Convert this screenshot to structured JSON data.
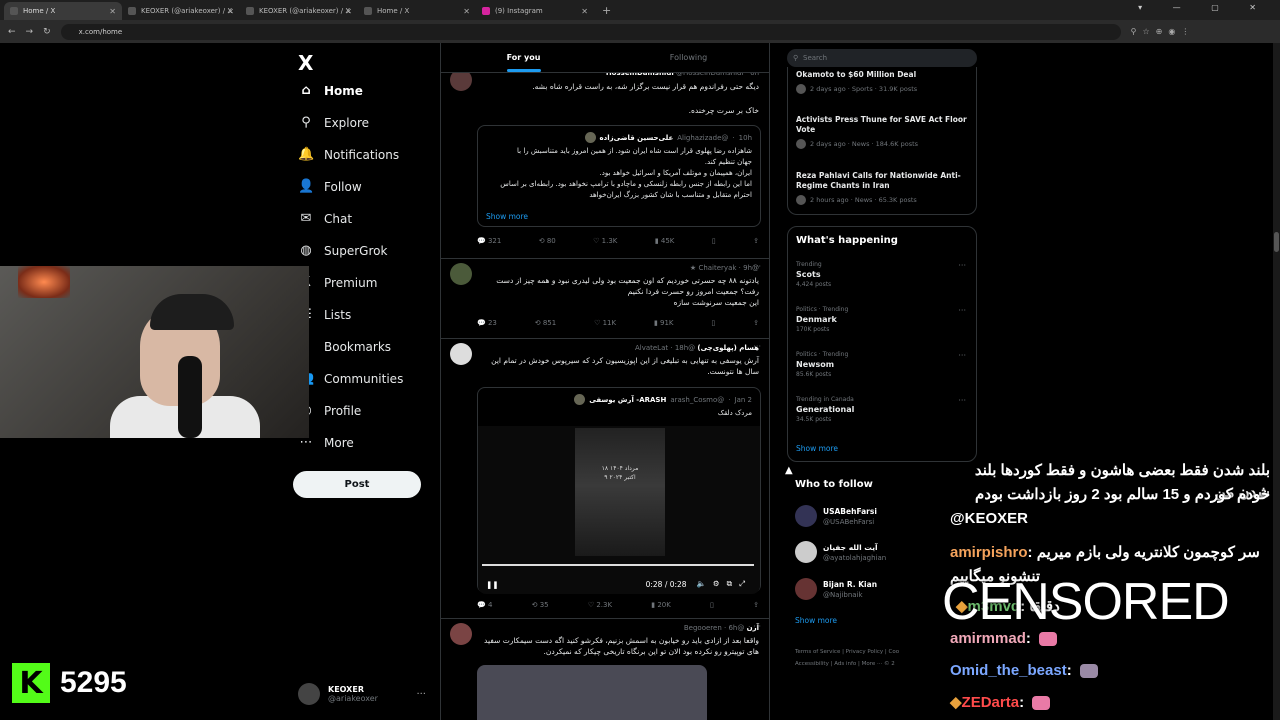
{
  "browser": {
    "tabs": [
      {
        "title": "Home / X",
        "active": true
      },
      {
        "title": "KEOXER (@ariakeoxer) / X",
        "active": false
      },
      {
        "title": "KEOXER (@ariakeoxer) / X",
        "active": false
      },
      {
        "title": "Home / X",
        "active": false
      },
      {
        "title": "(9) Instagram",
        "active": false
      }
    ],
    "url": "x.com/home"
  },
  "sidebar": {
    "logo": "X",
    "items": [
      {
        "label": "Home",
        "icon": "home-icon",
        "glyph": "⌂"
      },
      {
        "label": "Explore",
        "icon": "search-icon",
        "glyph": "⚲"
      },
      {
        "label": "Notifications",
        "icon": "bell-icon",
        "glyph": "🔔"
      },
      {
        "label": "Follow",
        "icon": "person-add-icon",
        "glyph": "👤"
      },
      {
        "label": "Chat",
        "icon": "mail-icon",
        "glyph": "✉"
      },
      {
        "label": "SuperGrok",
        "icon": "grok-icon",
        "glyph": "◍"
      },
      {
        "label": "Premium",
        "icon": "premium-icon",
        "glyph": "𝕏"
      },
      {
        "label": "Lists",
        "icon": "list-icon",
        "glyph": "☰"
      },
      {
        "label": "Bookmarks",
        "icon": "bookmark-icon",
        "glyph": "▯"
      },
      {
        "label": "Communities",
        "icon": "communities-icon",
        "glyph": "👥"
      },
      {
        "label": "Profile",
        "icon": "profile-icon",
        "glyph": "○"
      },
      {
        "label": "More",
        "icon": "more-icon",
        "glyph": "⋯"
      }
    ],
    "post": "Post",
    "account": {
      "name": "KEOXER",
      "handle": "@ariakeoxer"
    }
  },
  "feed": {
    "tabs": [
      "For you",
      "Following"
    ],
    "tweets": [
      {
        "author": "HosseinDamshidi",
        "handle": "@HosseinDamshidi",
        "time": "6h",
        "text": "دیگه حتی رفراندوم هم قرار نیست برگزار شه، به راست قراره شاه بشه.",
        "text2": "خاک بر سرت چرخنده.",
        "quote": {
          "author": "علی‌حسین قاضی‌زاده",
          "handle": "@Alighazizade",
          "time": "10h",
          "lines": [
            "شاهزاده رضا پهلوی قرار است شاه ایران شود. از همین امروز باید متناسبش را با",
            "جهان تنظیم کند.",
            "ایران، همپیمان و موتلف آمریکا و اسرائیل خواهد بود.",
            "اما این رابطه از جنس رابطه زلنسکی و ماچادو با ترامپ نخواهد بود. رابطه‌ای بر اساس",
            "احترام متقابل و متناسب با شان کشور بزرگ ایران‌خواهد"
          ],
          "show_more": "Show more"
        },
        "stats": [
          "321",
          "80",
          "1.3K",
          "45K"
        ]
      },
      {
        "author": "",
        "handle": "@Chaiteryak",
        "time": "9h",
        "lines": [
          "یادتونه ۸۸ چه حسرتی خوردیم که اون جمعیت بود ولی لیدری نبود و همه چیز از دست",
          "رفت؟ جمعیت امروز رو حسرت فردا نکنیم",
          "این جمعیت سرنوشت سازه"
        ],
        "stats": [
          "23",
          "851",
          "11K",
          "91K"
        ]
      },
      {
        "author": "هسام (پهلوی‌چی)",
        "handle": "@AlvateLat",
        "time": "18h",
        "lines": [
          "آرش یوسفی به تنهایی به تبلیغی از این اپوزیسیون کرد که سیرپوس خودش در تمام این",
          "سال ها نتونست."
        ],
        "quote": {
          "author": "ARASH- آرش یوسفی",
          "handle": "@arash_Cosmo",
          "time": "Jan 2",
          "text": "مردک دلقک",
          "video_caption": [
            "۱۸ مرداد ۱۴۰۴",
            "۹ اکتبر ۲۰۲۴"
          ],
          "video_time": "0:28 / 0:28"
        },
        "stats": [
          "4",
          "35",
          "2.3K",
          "20K"
        ]
      },
      {
        "author": "آرن",
        "handle": "@Begooeren",
        "time": "6h",
        "lines": [
          "واقعا بعد از ازادی باید رو خیابون به اسمش بزنیم، فکرشو کنید اگه دست سیمکارت سفید",
          "های توپیترو رو نکرده بود الان تو این برنگاه تاریخی چیکار که نمیکردن."
        ]
      }
    ]
  },
  "right": {
    "search_placeholder": "Search",
    "news": [
      {
        "title": "Okamoto to $60 Million Deal",
        "meta": "2 days ago · Sports · 31.9K posts"
      },
      {
        "title": "Activists Press Thune for SAVE Act Floor Vote",
        "meta": "2 days ago · News · 184.6K posts"
      },
      {
        "title": "Reza Pahlavi Calls for Nationwide Anti-Regime Chants in Iran",
        "meta": "2 hours ago · News · 65.3K posts"
      }
    ],
    "whats_happening": "What's happening",
    "trends": [
      {
        "context": "Trending",
        "name": "Scots",
        "posts": "4,424 posts"
      },
      {
        "context": "Politics · Trending",
        "name": "Denmark",
        "posts": "170K posts"
      },
      {
        "context": "Politics · Trending",
        "name": "Newsom",
        "posts": "85.6K posts"
      },
      {
        "context": "Trending in Canada",
        "name": "Generational",
        "posts": "34.5K posts"
      }
    ],
    "show_more": "Show more",
    "who_to_follow": "Who to follow",
    "follow": [
      {
        "name": "USABehFarsi",
        "handle": "@USABehFarsi"
      },
      {
        "name": "آیت الله جفیان",
        "handle": "@ayatolahjaghian"
      },
      {
        "name": "Bijan R. Kian",
        "handle": "@Najibnaik"
      }
    ],
    "show_more2": "Show more",
    "footer": "Terms of Service  |  Privacy Policy  |  Coo  Accessibility  |  Ads info  |  More ···  © 2"
  },
  "stream": {
    "viewer_count": "5295",
    "chat": [
      {
        "text": "بلند شدن فقط بعضی هاشون و فقط کوردها بلند شدن من"
      },
      {
        "text": "خودم کوردم و 15 سالم بود 2 روز بازداشت بودم"
      },
      {
        "text": "@KEOXER"
      },
      {
        "user": "amirpishro",
        "text": "سر کوچمون کلانتریه ولی بازم میریم"
      },
      {
        "text": "تنشونو میگاییم"
      },
      {
        "user": "m3mvd",
        "text": "دقیقا"
      },
      {
        "user": "amirmmad",
        "text": ""
      },
      {
        "user": "Omid_the_beast",
        "text": ""
      },
      {
        "user": "ZEDarta",
        "text": ""
      }
    ],
    "overlay": "CENSORED"
  }
}
